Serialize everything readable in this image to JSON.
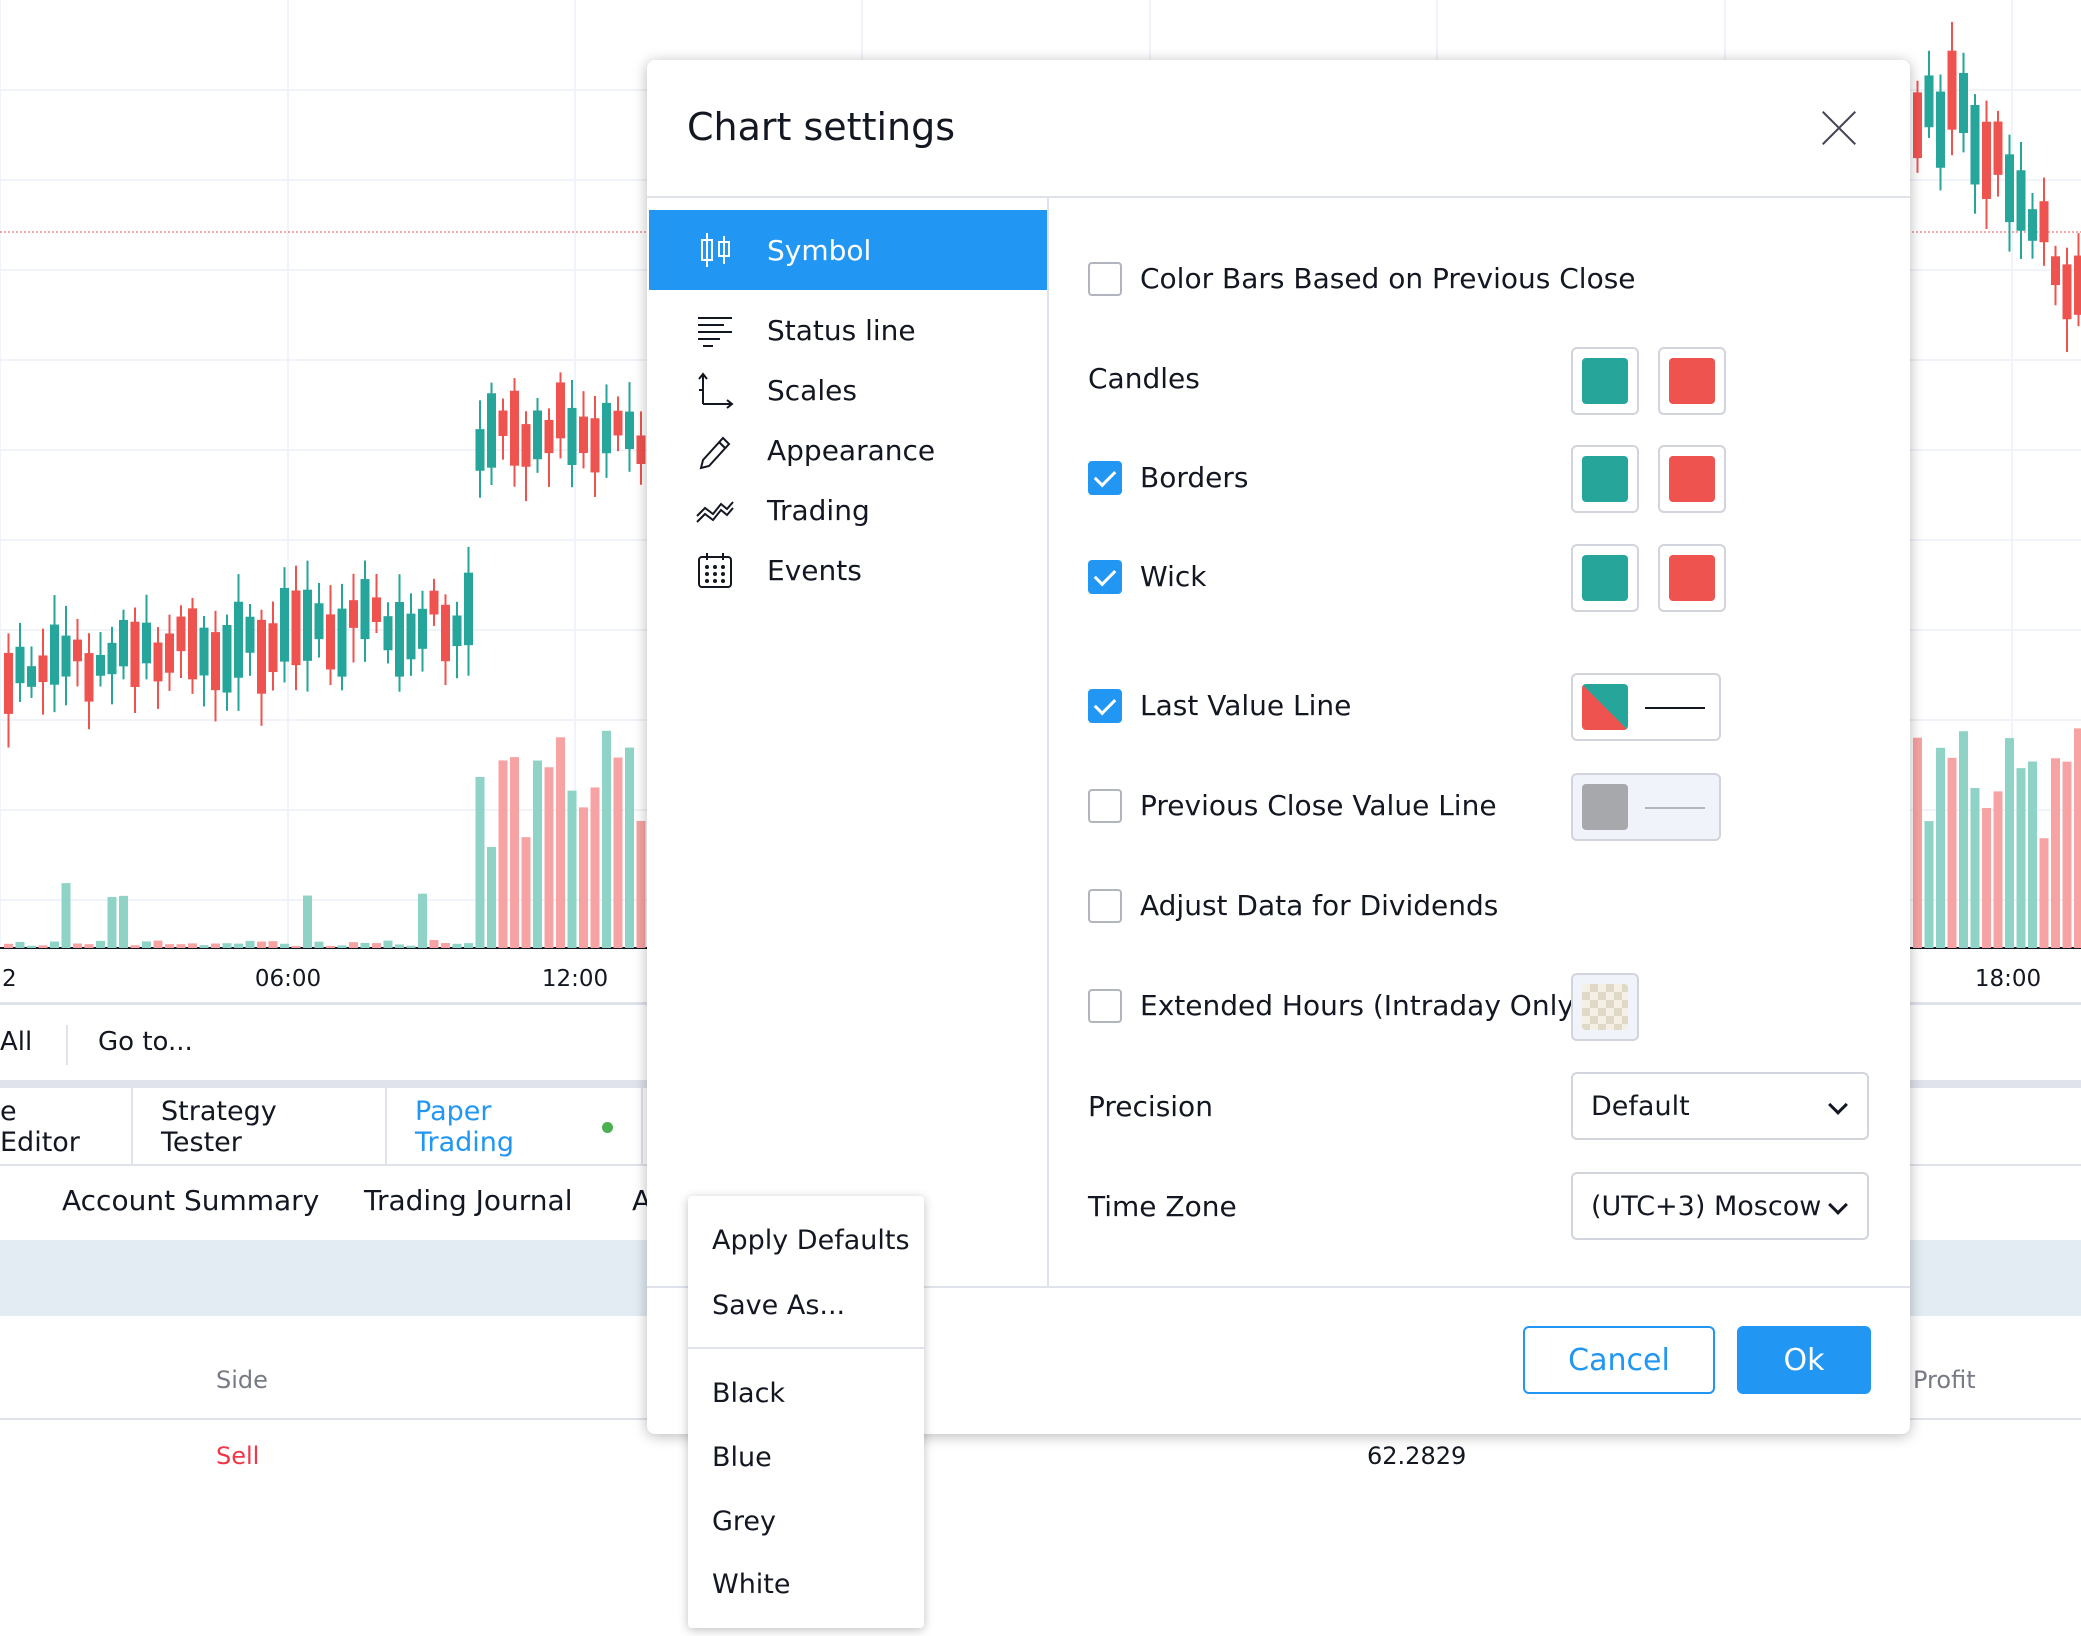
{
  "chart": {
    "time_labels": [
      "2",
      "06:00",
      "12:00",
      "18:00"
    ],
    "colors": {
      "up": "#26a69a",
      "down": "#ef5350",
      "up_volume": "#8fd3c7",
      "down_volume": "#f7a3a3",
      "price_line": "#ef5350"
    }
  },
  "range_bar": {
    "all_label": "All",
    "goto_label": "Go to..."
  },
  "bottom_tabs": [
    {
      "label": "e Editor"
    },
    {
      "label": "Strategy Tester"
    },
    {
      "label": "Paper Trading"
    },
    {
      "label": ""
    }
  ],
  "sub_tabs": [
    "Account Summary",
    "Trading Journal",
    "A"
  ],
  "table": {
    "headers": {
      "side": "Side",
      "profit": "Profit"
    },
    "row": {
      "side": "Sell",
      "value": "62.2829"
    }
  },
  "dialog": {
    "title": "Chart settings",
    "nav": [
      {
        "label": "Symbol",
        "icon": "candles-icon",
        "active": true
      },
      {
        "label": "Status line",
        "icon": "status-line-icon",
        "active": false
      },
      {
        "label": "Scales",
        "icon": "scales-icon",
        "active": false
      },
      {
        "label": "Appearance",
        "icon": "pencil-icon",
        "active": false
      },
      {
        "label": "Trading",
        "icon": "trading-icon",
        "active": false
      },
      {
        "label": "Events",
        "icon": "calendar-icon",
        "active": false
      }
    ],
    "settings": {
      "color_bars": {
        "label": "Color Bars Based on Previous Close",
        "checked": false
      },
      "candles": {
        "label": "Candles",
        "up_color": "#26a69a",
        "down_color": "#ef5350"
      },
      "borders": {
        "label": "Borders",
        "checked": true,
        "up_color": "#26a69a",
        "down_color": "#ef5350"
      },
      "wick": {
        "label": "Wick",
        "checked": true,
        "up_color": "#26a69a",
        "down_color": "#ef5350"
      },
      "last_value_line": {
        "label": "Last Value Line",
        "checked": true
      },
      "prev_close_line": {
        "label": "Previous Close Value Line",
        "checked": false,
        "color": "#a7a8ab"
      },
      "adjust_dividends": {
        "label": "Adjust Data for Dividends",
        "checked": false
      },
      "extended_hours": {
        "label": "Extended Hours (Intraday Only)",
        "checked": false
      },
      "precision": {
        "label": "Precision",
        "value": "Default"
      },
      "timezone": {
        "label": "Time Zone",
        "value": "(UTC+3) Moscow"
      }
    },
    "buttons": {
      "cancel": "Cancel",
      "ok": "Ok"
    }
  },
  "template_menu": {
    "items": [
      "Apply Defaults",
      "Save As..."
    ],
    "themes": [
      "Black",
      "Blue",
      "Grey",
      "White"
    ]
  }
}
